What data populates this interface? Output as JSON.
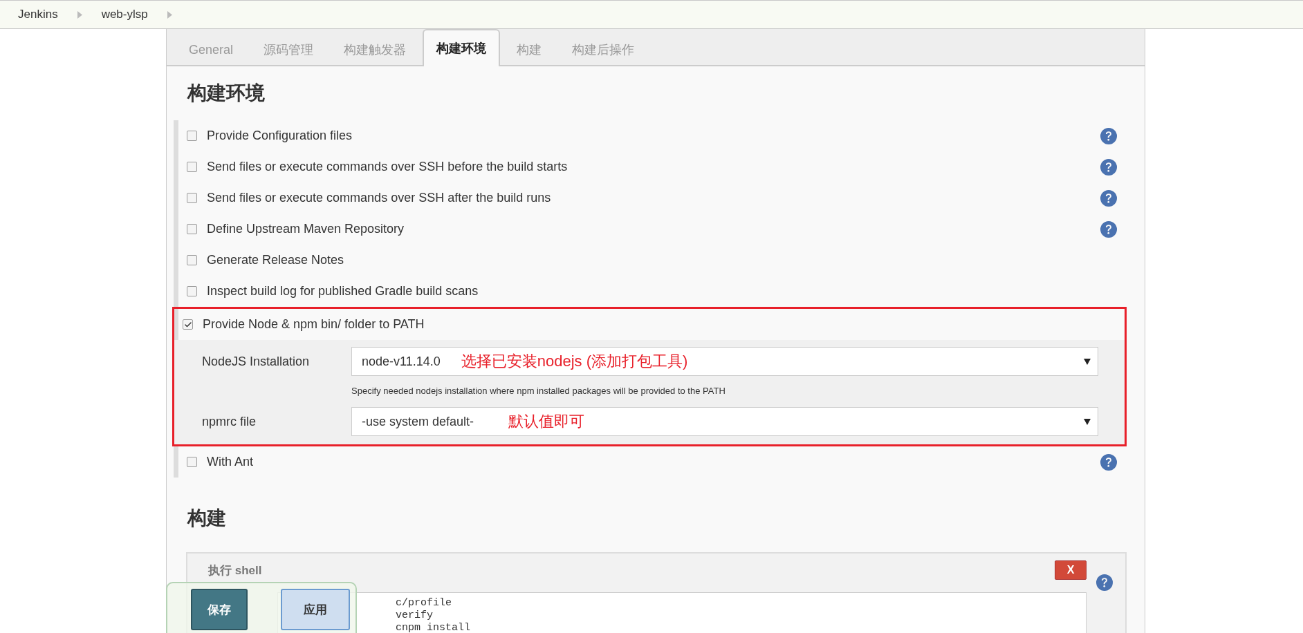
{
  "breadcrumbs": [
    {
      "label": "Jenkins"
    },
    {
      "label": "web-ylsp"
    }
  ],
  "tabs": [
    {
      "label": "General",
      "selected": false
    },
    {
      "label": "源码管理",
      "selected": false
    },
    {
      "label": "构建触发器",
      "selected": false
    },
    {
      "label": "构建环境",
      "selected": true
    },
    {
      "label": "构建",
      "selected": false
    },
    {
      "label": "构建后操作",
      "selected": false
    }
  ],
  "environment": {
    "title": "构建环境",
    "options": [
      {
        "label": "Provide Configuration files",
        "checked": false,
        "help": true
      },
      {
        "label": "Send files or execute commands over SSH before the build starts",
        "checked": false,
        "help": true
      },
      {
        "label": "Send files or execute commands over SSH after the build runs",
        "checked": false,
        "help": true
      },
      {
        "label": "Define Upstream Maven Repository",
        "checked": false,
        "help": true
      },
      {
        "label": "Generate Release Notes",
        "checked": false,
        "help": false
      },
      {
        "label": "Inspect build log for published Gradle build scans",
        "checked": false,
        "help": false
      },
      {
        "label": "Provide Node & npm bin/ folder to PATH",
        "checked": true,
        "help": false,
        "highlighted": true,
        "settings": [
          {
            "label": "NodeJS Installation",
            "value": "node-v11.14.0",
            "note": "选择已安装nodejs (添加打包工具)",
            "hint": "Specify needed nodejs installation where npm installed packages will be provided to the PATH"
          },
          {
            "label": "npmrc file",
            "value": "-use system default-",
            "note": "默认值即可"
          }
        ]
      },
      {
        "label": "With Ant",
        "checked": false,
        "help": true
      }
    ]
  },
  "build": {
    "title": "构建",
    "step": {
      "title": "执行 shell",
      "delete": "X",
      "script": [
        "c/profile",
        "verify",
        "cnpm install"
      ]
    }
  },
  "actions": [
    {
      "label": "保存",
      "kind": "primary"
    },
    {
      "label": "应用",
      "kind": "secondary"
    }
  ]
}
